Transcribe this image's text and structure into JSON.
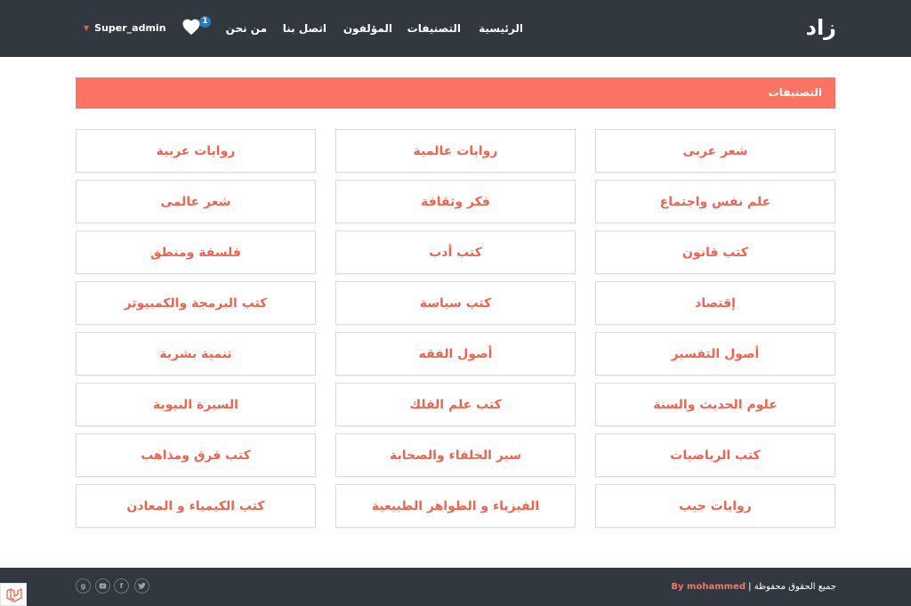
{
  "navbar": {
    "brand": "زاد",
    "items": [
      "الرئيسية",
      "التصنيفات",
      "المؤلفون",
      "اتصل بنا",
      "من نحن"
    ],
    "favorites_count": "1",
    "user": "Super_admin"
  },
  "section": {
    "title": "التصنيفات"
  },
  "categories": [
    "شعر عربى",
    "روايات عالمية",
    "روايات عربية",
    "علم نفس واجتماع",
    "فكر وثقافة",
    "شعر عالمى",
    "كتب قانون",
    "كتب أدب",
    "فلسفة ومنطق",
    "إقتصاد",
    "كتب سياسة",
    "كتب البرمجة والكمبيوتر",
    "أصول التفسير",
    "أصول الفقه",
    "تنمية بشرية",
    "علوم الحديث والسنة",
    "كتب علم الفلك",
    "السيرة النبوية",
    "كتب الرياضيات",
    "سير الخلفاء والصحابة",
    "كتب فرق ومذاهب",
    "روايات جيب",
    "الفيزياء و الظواهر الطبيعية",
    "كتب الكيمياء و المعادن"
  ],
  "footer": {
    "rights": "جميع الحقوق محفوظة |",
    "by": "By mohammed",
    "social": [
      "twitter-icon",
      "facebook-icon",
      "youtube-icon",
      "google-plus-icon"
    ]
  },
  "colors": {
    "navbar": "#313840",
    "accent": "#fb7461",
    "category_text": "#f0634f",
    "badge": "#2b7bb9"
  }
}
